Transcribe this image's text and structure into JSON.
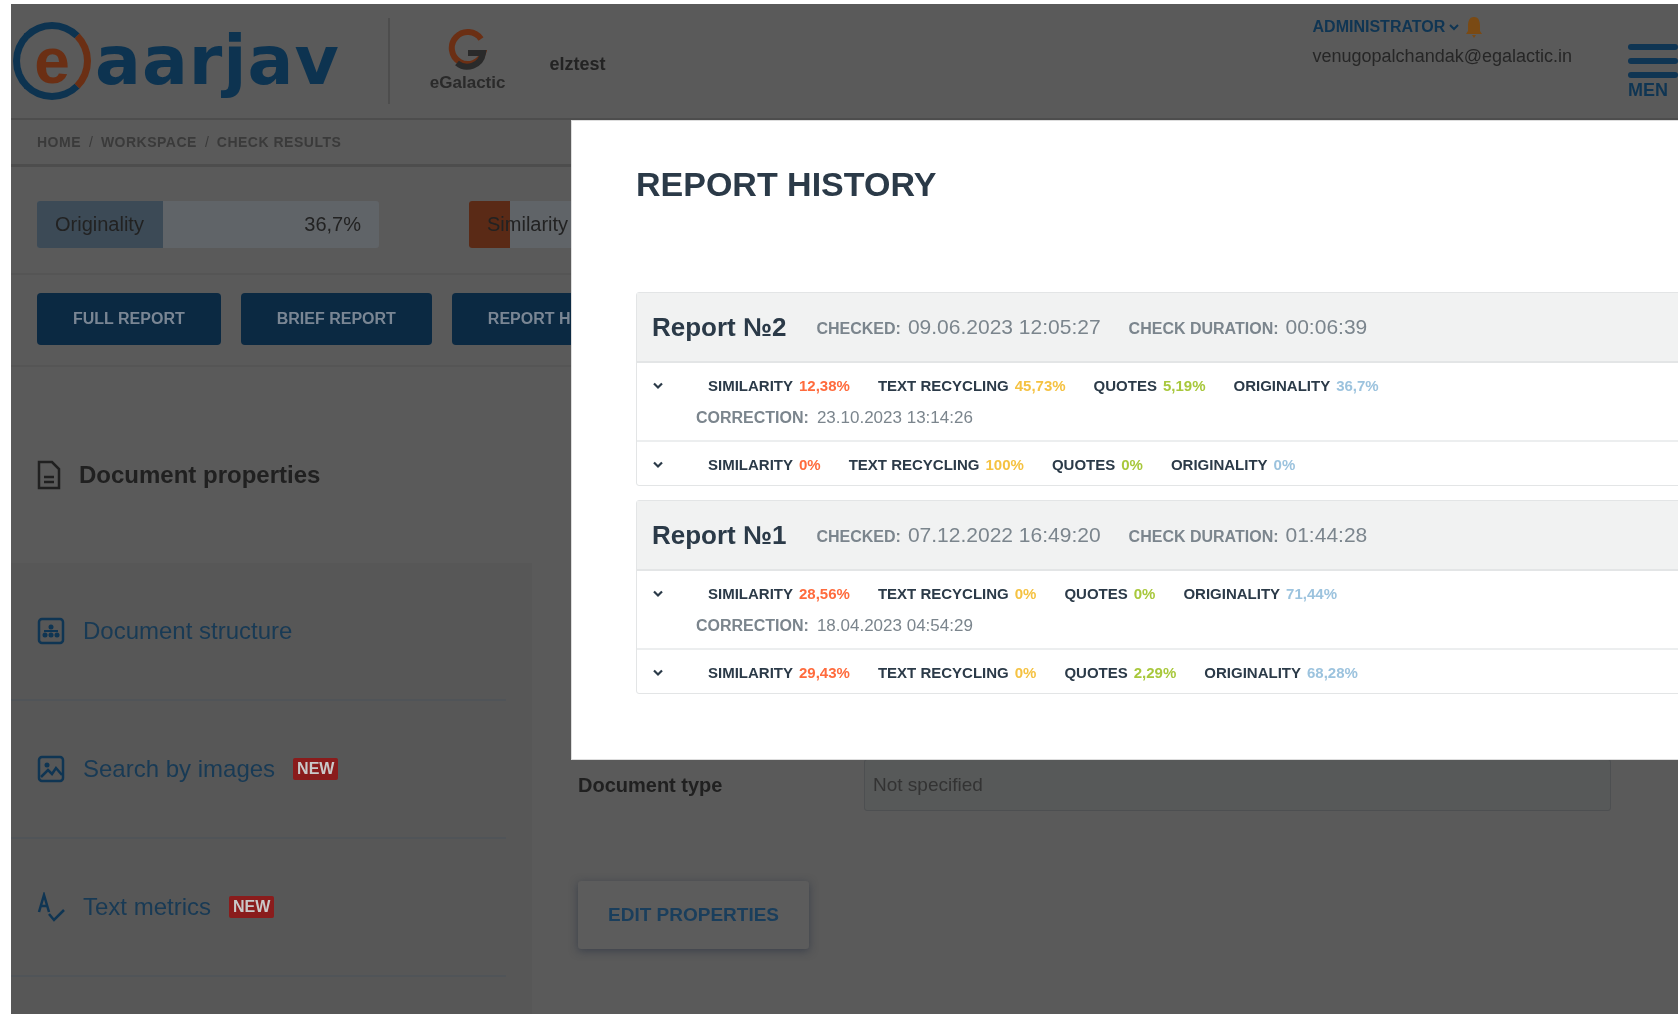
{
  "header": {
    "logo": {
      "mark": "e",
      "name": "aarjav"
    },
    "partner": {
      "name": "eGalactic"
    },
    "workspace": "elztest",
    "user": {
      "role": "ADMINISTRATOR",
      "email": "venugopalchandak@egalactic.in"
    },
    "menu_label": "MEN"
  },
  "breadcrumb": {
    "separator": "/",
    "items": [
      "HOME",
      "WORKSPACE",
      "CHECK RESULTS"
    ]
  },
  "score_bars": [
    {
      "kind": "originality",
      "label": "Originality",
      "value": "36,7%",
      "level": 0.367
    },
    {
      "kind": "similarity",
      "label": "Similarity",
      "level": 0.12
    }
  ],
  "action_buttons": [
    "FULL REPORT",
    "BRIEF REPORT",
    "REPORT H"
  ],
  "sidebar": {
    "title": "Document properties",
    "items": [
      {
        "kind": "structure",
        "label": "Document structure"
      },
      {
        "kind": "images",
        "label": "Search by images",
        "badge": "NEW"
      },
      {
        "kind": "metrics",
        "label": "Text metrics",
        "badge": "NEW"
      }
    ]
  },
  "properties": {
    "fields": [
      {
        "label": "Document type",
        "value": "Not specified"
      }
    ],
    "edit_button": "EDIT PROPERTIES"
  },
  "modal": {
    "title": "REPORT HISTORY",
    "reports": [
      {
        "title": "Report №2",
        "checked_label": "CHECKED:",
        "checked": "09.06.2023 12:05:27",
        "duration_label": "CHECK DURATION:",
        "duration": "00:06:39",
        "rows": [
          {
            "metrics": [
              {
                "kind": "similarity",
                "label": "SIMILARITY",
                "value": "12,38%"
              },
              {
                "kind": "recycling",
                "label": "TEXT RECYCLING",
                "value": "45,73%"
              },
              {
                "kind": "quotes",
                "label": "QUOTES",
                "value": "5,19%"
              },
              {
                "kind": "originality",
                "label": "ORIGINALITY",
                "value": "36,7%"
              }
            ],
            "correction_label": "CORRECTION:",
            "correction": "23.10.2023 13:14:26"
          },
          {
            "metrics": [
              {
                "kind": "similarity",
                "label": "SIMILARITY",
                "value": "0%"
              },
              {
                "kind": "recycling",
                "label": "TEXT RECYCLING",
                "value": "100%"
              },
              {
                "kind": "quotes",
                "label": "QUOTES",
                "value": "0%"
              },
              {
                "kind": "originality",
                "label": "ORIGINALITY",
                "value": "0%"
              }
            ]
          }
        ]
      },
      {
        "title": "Report №1",
        "checked_label": "CHECKED:",
        "checked": "07.12.2022 16:49:20",
        "duration_label": "CHECK DURATION:",
        "duration": "01:44:28",
        "rows": [
          {
            "metrics": [
              {
                "kind": "similarity",
                "label": "SIMILARITY",
                "value": "28,56%"
              },
              {
                "kind": "recycling",
                "label": "TEXT RECYCLING",
                "value": "0%"
              },
              {
                "kind": "quotes",
                "label": "QUOTES",
                "value": "0%"
              },
              {
                "kind": "originality",
                "label": "ORIGINALITY",
                "value": "71,44%"
              }
            ],
            "correction_label": "CORRECTION:",
            "correction": "18.04.2023 04:54:29"
          },
          {
            "metrics": [
              {
                "kind": "similarity",
                "label": "SIMILARITY",
                "value": "29,43%"
              },
              {
                "kind": "recycling",
                "label": "TEXT RECYCLING",
                "value": "0%"
              },
              {
                "kind": "quotes",
                "label": "QUOTES",
                "value": "2,29%"
              },
              {
                "kind": "originality",
                "label": "ORIGINALITY",
                "value": "68,28%"
              }
            ]
          }
        ]
      }
    ]
  }
}
